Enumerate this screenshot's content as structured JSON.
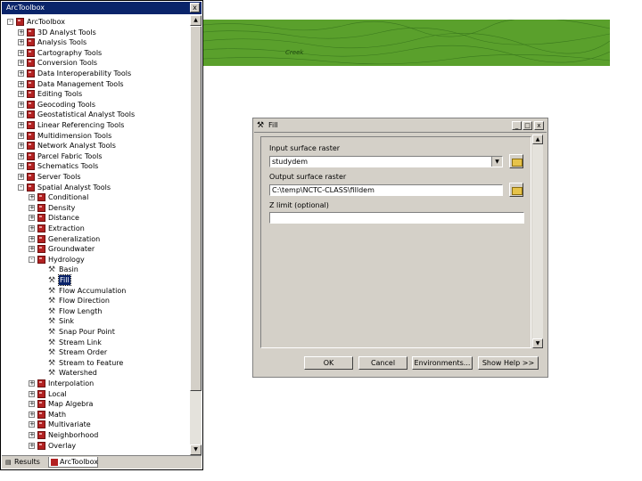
{
  "toolbox": {
    "title": "ArcToolbox",
    "close_label": "x",
    "items": [
      {
        "label": "ArcToolbox",
        "level": 0,
        "expander": "-",
        "icon": "toolbox-icon"
      },
      {
        "label": "3D Analyst Tools",
        "level": 1,
        "expander": "+",
        "icon": "toolbox-icon"
      },
      {
        "label": "Analysis Tools",
        "level": 1,
        "expander": "+",
        "icon": "toolbox-icon"
      },
      {
        "label": "Cartography Tools",
        "level": 1,
        "expander": "+",
        "icon": "toolbox-icon"
      },
      {
        "label": "Conversion Tools",
        "level": 1,
        "expander": "+",
        "icon": "toolbox-icon"
      },
      {
        "label": "Data Interoperability Tools",
        "level": 1,
        "expander": "+",
        "icon": "toolbox-icon"
      },
      {
        "label": "Data Management Tools",
        "level": 1,
        "expander": "+",
        "icon": "toolbox-icon"
      },
      {
        "label": "Editing Tools",
        "level": 1,
        "expander": "+",
        "icon": "toolbox-icon"
      },
      {
        "label": "Geocoding Tools",
        "level": 1,
        "expander": "+",
        "icon": "toolbox-icon"
      },
      {
        "label": "Geostatistical Analyst Tools",
        "level": 1,
        "expander": "+",
        "icon": "toolbox-icon"
      },
      {
        "label": "Linear Referencing Tools",
        "level": 1,
        "expander": "+",
        "icon": "toolbox-icon"
      },
      {
        "label": "Multidimension Tools",
        "level": 1,
        "expander": "+",
        "icon": "toolbox-icon"
      },
      {
        "label": "Network Analyst Tools",
        "level": 1,
        "expander": "+",
        "icon": "toolbox-icon"
      },
      {
        "label": "Parcel Fabric Tools",
        "level": 1,
        "expander": "+",
        "icon": "toolbox-icon"
      },
      {
        "label": "Schematics Tools",
        "level": 1,
        "expander": "+",
        "icon": "toolbox-icon"
      },
      {
        "label": "Server Tools",
        "level": 1,
        "expander": "+",
        "icon": "toolbox-icon"
      },
      {
        "label": "Spatial Analyst Tools",
        "level": 1,
        "expander": "-",
        "icon": "toolbox-icon"
      },
      {
        "label": "Conditional",
        "level": 2,
        "expander": "+",
        "icon": "toolset-icon"
      },
      {
        "label": "Density",
        "level": 2,
        "expander": "+",
        "icon": "toolset-icon"
      },
      {
        "label": "Distance",
        "level": 2,
        "expander": "+",
        "icon": "toolset-icon"
      },
      {
        "label": "Extraction",
        "level": 2,
        "expander": "+",
        "icon": "toolset-icon"
      },
      {
        "label": "Generalization",
        "level": 2,
        "expander": "+",
        "icon": "toolset-icon"
      },
      {
        "label": "Groundwater",
        "level": 2,
        "expander": "+",
        "icon": "toolset-icon"
      },
      {
        "label": "Hydrology",
        "level": 2,
        "expander": "-",
        "icon": "toolset-icon"
      },
      {
        "label": "Basin",
        "level": 3,
        "expander": "",
        "icon": "hammer-icon"
      },
      {
        "label": "Fill",
        "level": 3,
        "expander": "",
        "icon": "hammer-icon",
        "selected": true
      },
      {
        "label": "Flow Accumulation",
        "level": 3,
        "expander": "",
        "icon": "hammer-icon"
      },
      {
        "label": "Flow Direction",
        "level": 3,
        "expander": "",
        "icon": "hammer-icon"
      },
      {
        "label": "Flow Length",
        "level": 3,
        "expander": "",
        "icon": "hammer-icon"
      },
      {
        "label": "Sink",
        "level": 3,
        "expander": "",
        "icon": "hammer-icon"
      },
      {
        "label": "Snap Pour Point",
        "level": 3,
        "expander": "",
        "icon": "hammer-icon"
      },
      {
        "label": "Stream Link",
        "level": 3,
        "expander": "",
        "icon": "hammer-icon"
      },
      {
        "label": "Stream Order",
        "level": 3,
        "expander": "",
        "icon": "hammer-icon"
      },
      {
        "label": "Stream to Feature",
        "level": 3,
        "expander": "",
        "icon": "hammer-icon"
      },
      {
        "label": "Watershed",
        "level": 3,
        "expander": "",
        "icon": "hammer-icon"
      },
      {
        "label": "Interpolation",
        "level": 2,
        "expander": "+",
        "icon": "toolset-icon"
      },
      {
        "label": "Local",
        "level": 2,
        "expander": "+",
        "icon": "toolset-icon"
      },
      {
        "label": "Map Algebra",
        "level": 2,
        "expander": "+",
        "icon": "toolset-icon"
      },
      {
        "label": "Math",
        "level": 2,
        "expander": "+",
        "icon": "toolset-icon"
      },
      {
        "label": "Multivariate",
        "level": 2,
        "expander": "+",
        "icon": "toolset-icon"
      },
      {
        "label": "Neighborhood",
        "level": 2,
        "expander": "+",
        "icon": "toolset-icon"
      },
      {
        "label": "Overlay",
        "level": 2,
        "expander": "+",
        "icon": "toolset-icon"
      }
    ],
    "tabs": {
      "results": "Results",
      "toolbox": "ArcToolbox"
    }
  },
  "map": {
    "label": "Creek",
    "color": "#5aa02c"
  },
  "fill_dialog": {
    "title": "Fill",
    "window_buttons": {
      "minimize": "_",
      "maximize": "□",
      "close": "x"
    },
    "input_label": "Input surface raster",
    "input_value": "studydem",
    "output_label": "Output surface raster",
    "output_value": "C:\\temp\\NCTC-CLASS\\filldem",
    "zlimit_label": "Z limit (optional)",
    "zlimit_value": "",
    "buttons": {
      "ok": "OK",
      "cancel": "Cancel",
      "environments": "Environments...",
      "show_help": "Show Help >>"
    }
  },
  "colors": {
    "titlebar_active": "#0a246a",
    "dialog_face": "#d4d0c8",
    "toolbox_icon": "#b22222"
  }
}
